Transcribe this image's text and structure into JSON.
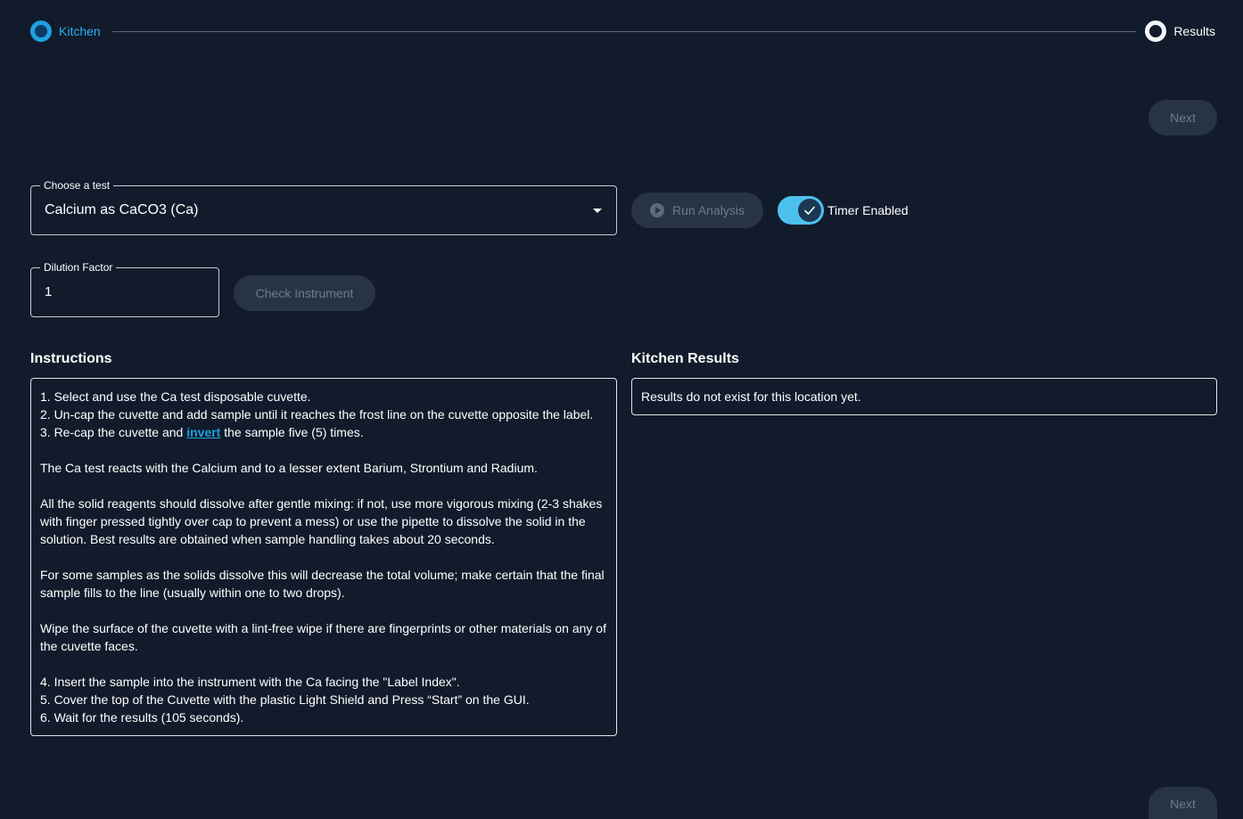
{
  "stepper": {
    "step1_label": "Kitchen",
    "step2_label": "Results"
  },
  "nav": {
    "next_label": "Next"
  },
  "test_select": {
    "legend": "Choose a test",
    "value": "Calcium as CaCO3 (Ca)"
  },
  "run_analysis": {
    "label": "Run Analysis"
  },
  "timer": {
    "label": "Timer Enabled",
    "enabled": true
  },
  "dilution": {
    "legend": "Dilution Factor",
    "value": "1"
  },
  "check_instrument": {
    "label": "Check Instrument"
  },
  "instructions": {
    "title": "Instructions",
    "step1": "1. Select and use the Ca test disposable cuvette.",
    "step2": "2. Un-cap the cuvette and add sample until it reaches the frost line on the cuvette opposite the label.",
    "step3_pre": "3. Re-cap the cuvette and ",
    "step3_link": "invert",
    "step3_post": " the sample five (5) times.",
    "para1": "The Ca test reacts with the Calcium and to a lesser extent Barium, Strontium and Radium.",
    "para2": "All the solid reagents should dissolve after gentle mixing: if not, use more vigorous mixing (2-3 shakes with finger pressed tightly over cap to prevent a mess) or use the pipette to dissolve the solid in the solution. Best results are obtained when sample handling takes about 20 seconds.",
    "para3": "For some samples as the solids dissolve this will decrease the total volume; make certain that the final sample fills to the line (usually within one to two drops).",
    "para4": "Wipe the surface of the cuvette with a lint-free wipe if there are fingerprints or other materials on any of the cuvette faces.",
    "step4": "4. Insert the sample into the instrument with the Ca facing the \"Label Index\".",
    "step5": "5. Cover the top of the Cuvette with the plastic Light Shield and Press “Start” on the GUI.",
    "step6": "6. Wait for the results (105 seconds)."
  },
  "kitchen_results": {
    "title": "Kitchen Results",
    "message": "Results do not exist for this location yet."
  },
  "colors": {
    "background": "#111b2b",
    "accent": "#1fa1e0",
    "toggle_on": "#4cc1ee",
    "disabled_button": "#283445"
  }
}
